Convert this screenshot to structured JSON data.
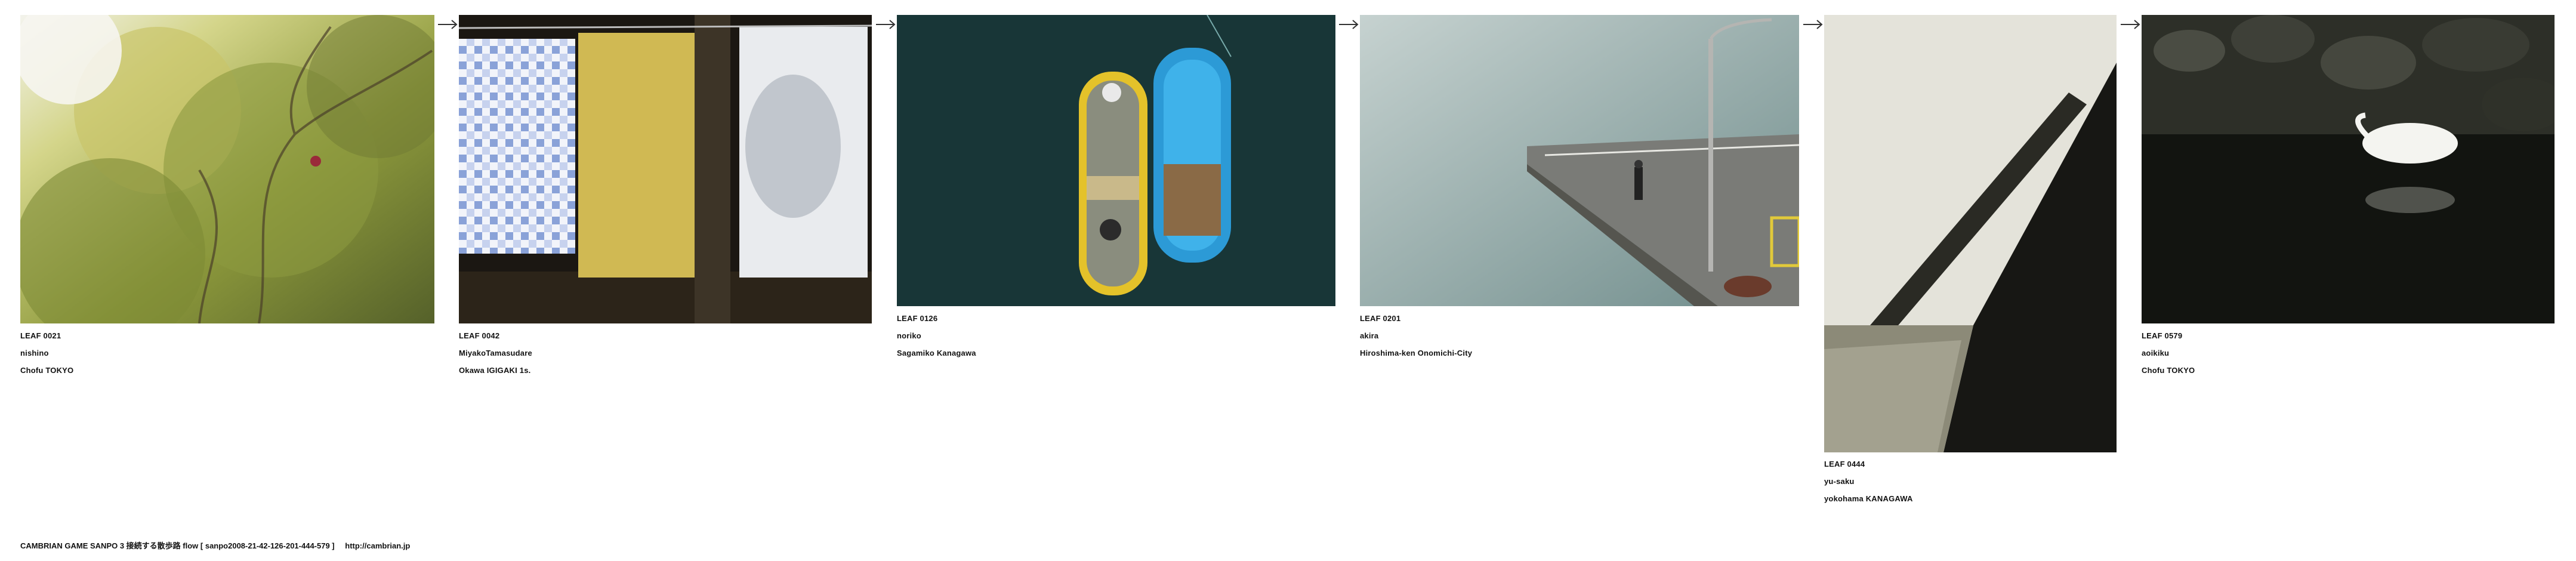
{
  "leaves": [
    {
      "id": "LEAF 0021",
      "name": "nishino",
      "place": "Chofu TOKYO",
      "image": "tree with autumn foliage"
    },
    {
      "id": "LEAF 0042",
      "name": "MiyakoTamasudare",
      "place": "Okawa IGIGAKI 1s.",
      "image": "laundry hanging in sunlight"
    },
    {
      "id": "LEAF 0126",
      "name": "noriko",
      "place": "Sagamiko Kanagawa",
      "image": "two rowing boats seen from above"
    },
    {
      "id": "LEAF 0201",
      "name": "akira",
      "place": "Hiroshima-ken Onomichi-City",
      "image": "man standing on a pier"
    },
    {
      "id": "LEAF 0444",
      "name": "yu-saku",
      "place": "yokohama  KANAGAWA",
      "image": "shadow on a white wall"
    },
    {
      "id": "LEAF 0579",
      "name": "aoikiku",
      "place": "Chofu TOKYO",
      "image": "white egret by dark water"
    }
  ],
  "arrow_icon": "right-arrow-icon",
  "footer": {
    "text": "CAMBRIAN GAME  SANPO 3 接続する散歩路 flow [ sanpo2008-21-42-126-201-444-579 ]",
    "link": "http://cambrian.jp"
  }
}
